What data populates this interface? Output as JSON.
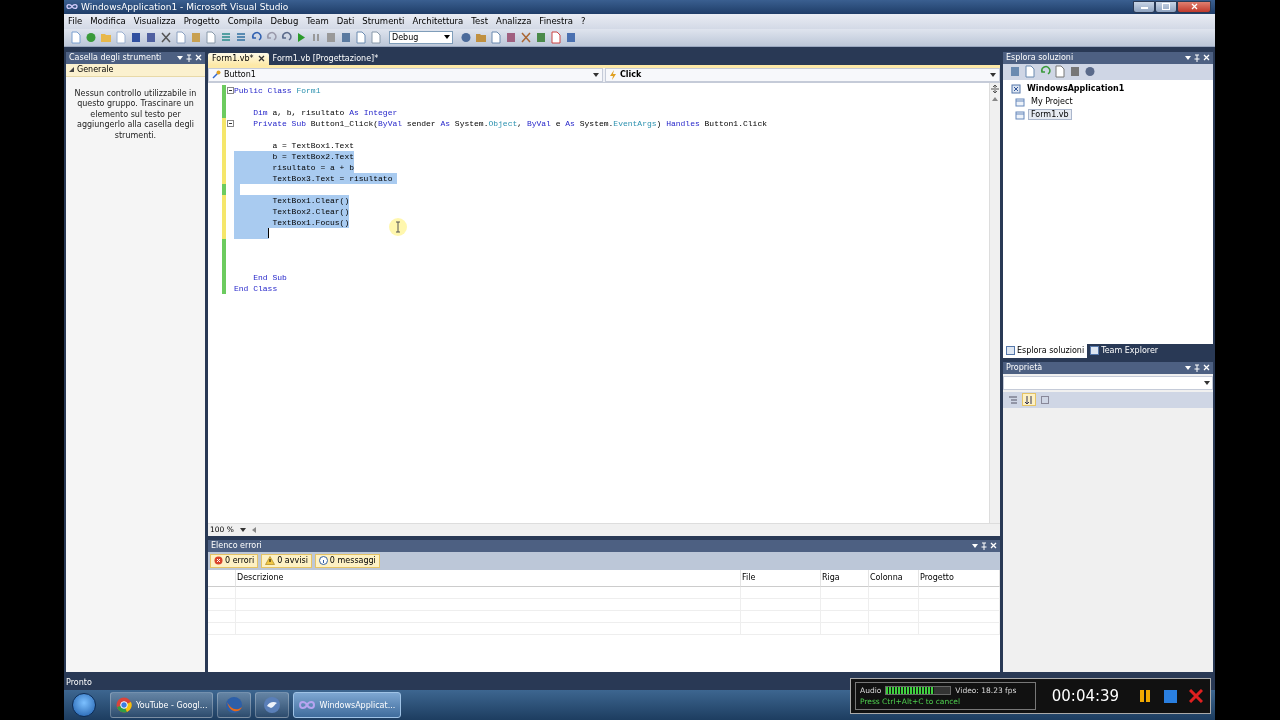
{
  "window": {
    "title": "WindowsApplication1 - Microsoft Visual Studio"
  },
  "menu": [
    "File",
    "Modifica",
    "Visualizza",
    "Progetto",
    "Compila",
    "Debug",
    "Team",
    "Dati",
    "Strumenti",
    "Architettura",
    "Test",
    "Analizza",
    "Finestra",
    "?"
  ],
  "toolbar": {
    "configuration": "Debug"
  },
  "toolbox": {
    "title": "Casella degli strumenti",
    "group": {
      "label": "Generale",
      "expanded": true
    },
    "message": "Nessun controllo utilizzabile in questo gruppo. Trascinare un elemento sul testo per aggiungerlo alla casella degli strumenti."
  },
  "editor": {
    "tabs": [
      {
        "label": "Form1.vb*",
        "selected": true
      },
      {
        "label": "Form1.vb [Progettazione]*",
        "selected": false
      }
    ],
    "object_dropdown": "Button1",
    "event_dropdown": "Click",
    "zoom": "100 %",
    "lines": [
      {
        "kind": "fold",
        "tokens": [
          {
            "kind": "keyword",
            "t": "Public Class "
          },
          {
            "kind": "type",
            "t": "Form1"
          }
        ],
        "modified": false,
        "selected": false
      },
      {
        "kind": "blank",
        "modified": false,
        "selected": false
      },
      {
        "kind": "code",
        "tokens": [
          {
            "kind": "keyword",
            "t": "    Dim"
          },
          {
            "kind": "plain",
            "t": " a, b, risultato "
          },
          {
            "kind": "keyword",
            "t": "As Integer"
          }
        ],
        "modified": false,
        "selected": false
      },
      {
        "kind": "fold",
        "tokens": [
          {
            "kind": "keyword",
            "t": "    Private Sub"
          },
          {
            "kind": "plain",
            "t": " Button1_Click("
          },
          {
            "kind": "keyword",
            "t": "ByVal"
          },
          {
            "kind": "plain",
            "t": " sender "
          },
          {
            "kind": "keyword",
            "t": "As"
          },
          {
            "kind": "plain",
            "t": " System."
          },
          {
            "kind": "type",
            "t": "Object"
          },
          {
            "kind": "plain",
            "t": ", "
          },
          {
            "kind": "keyword",
            "t": "ByVal"
          },
          {
            "kind": "plain",
            "t": " e "
          },
          {
            "kind": "keyword",
            "t": "As"
          },
          {
            "kind": "plain",
            "t": " System."
          },
          {
            "kind": "type",
            "t": "EventArgs"
          },
          {
            "kind": "plain",
            "t": ") "
          },
          {
            "kind": "keyword",
            "t": "Handles"
          },
          {
            "kind": "plain",
            "t": " Button1.Click"
          }
        ],
        "modified": true,
        "selected": false
      },
      {
        "kind": "blank",
        "modified": true,
        "selected": false
      },
      {
        "kind": "code",
        "tokens": [
          {
            "kind": "plain",
            "t": "        a = TextBox1.Text"
          }
        ],
        "modified": true,
        "selected": false
      },
      {
        "kind": "code",
        "tokens": [
          {
            "kind": "plain",
            "t": "        b = TextBox2.Text"
          }
        ],
        "modified": true,
        "selected": true
      },
      {
        "kind": "code",
        "tokens": [
          {
            "kind": "plain",
            "t": "        risultato = a + b"
          }
        ],
        "modified": true,
        "selected": true
      },
      {
        "kind": "code",
        "tokens": [
          {
            "kind": "plain",
            "t": "        TextBox3.Text = risultato "
          }
        ],
        "modified": true,
        "selected": true
      },
      {
        "kind": "blank",
        "modified": false,
        "selected": true
      },
      {
        "kind": "code",
        "tokens": [
          {
            "kind": "plain",
            "t": "        TextBox1.Clear()"
          }
        ],
        "modified": true,
        "selected": true
      },
      {
        "kind": "code",
        "tokens": [
          {
            "kind": "plain",
            "t": "        TextBox2.Clear()"
          }
        ],
        "modified": true,
        "selected": true
      },
      {
        "kind": "code",
        "tokens": [
          {
            "kind": "plain",
            "t": "        TextBox1.Focus()"
          }
        ],
        "modified": true,
        "selected": true
      },
      {
        "kind": "caret",
        "modified": true,
        "selected": true
      },
      {
        "kind": "blank",
        "modified": false,
        "selected": false
      },
      {
        "kind": "blank",
        "modified": false,
        "selected": false
      },
      {
        "kind": "blank",
        "modified": false,
        "selected": false
      },
      {
        "kind": "code",
        "tokens": [
          {
            "kind": "keyword",
            "t": "    End Sub"
          }
        ],
        "modified": false,
        "selected": false
      },
      {
        "kind": "code",
        "tokens": [
          {
            "kind": "keyword",
            "t": "End Class"
          }
        ],
        "modified": false,
        "selected": false
      }
    ]
  },
  "solution_explorer": {
    "title": "Esplora soluzioni",
    "tree": [
      {
        "label": "WindowsApplication1",
        "selected": false,
        "children": [
          {
            "label": "My Project",
            "selected": false
          },
          {
            "label": "Form1.vb",
            "selected": true
          }
        ]
      }
    ],
    "tabs": [
      {
        "label": "Esplora soluzioni",
        "selected": true
      },
      {
        "label": "Team Explorer",
        "selected": false
      }
    ]
  },
  "properties": {
    "title": "Proprietà"
  },
  "error_list": {
    "title": "Elenco errori",
    "filters": [
      {
        "kind": "error",
        "label": "0 errori",
        "selected": true
      },
      {
        "kind": "warning",
        "label": "0 avvisi",
        "selected": true
      },
      {
        "kind": "info",
        "label": "0 messaggi",
        "selected": true
      }
    ],
    "columns": [
      "Descrizione",
      "File",
      "Riga",
      "Colonna",
      "Progetto"
    ]
  },
  "status_bar": {
    "text": "Pronto"
  },
  "taskbar": {
    "items": [
      {
        "kind": "browser",
        "label": "YouTube - Googl...",
        "selected": false
      },
      {
        "kind": "fox",
        "selected": false
      },
      {
        "kind": "bird",
        "selected": false
      },
      {
        "kind": "studio",
        "label": "WindowsApplicat...",
        "selected": true
      }
    ]
  },
  "recorder": {
    "audio_label": "Audio",
    "audio": {
      "level": 0.75
    },
    "video": "Video: 18.23 fps",
    "hint": "Press Ctrl+Alt+C to cancel",
    "time": "00:04:39"
  }
}
